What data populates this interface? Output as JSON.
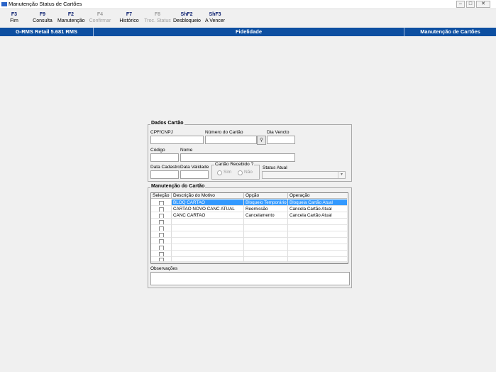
{
  "window": {
    "title": "Manutenção Status de Cartões"
  },
  "toolbar": {
    "buttons": [
      {
        "key": "F3",
        "label": "Fim"
      },
      {
        "key": "F9",
        "label": "Consulta"
      },
      {
        "key": "F2",
        "label": "Manutenção"
      },
      {
        "key": "F4",
        "label": "Confirmar"
      },
      {
        "key": "F7",
        "label": "Histórico"
      },
      {
        "key": "F8",
        "label": "Troc. Status"
      },
      {
        "key": "ShF2",
        "label": "Desbloqueio"
      },
      {
        "key": "ShF3",
        "label": "A Vencer"
      }
    ]
  },
  "statusbar": {
    "system": "G-RMS Retail 5.681 RMS",
    "module": "Fidelidade",
    "screen": "Manutenção de Cartões"
  },
  "dados_cartao": {
    "title": "Dados Cartão",
    "cpf_label": "CPF/CNPJ",
    "numero_label": "Número do Cartão",
    "dia_vencto_label": "Dia Vencto",
    "codigo_label": "Código",
    "nome_label": "Nome",
    "data_cadastro_label": "Data Cadastro",
    "data_validade_label": "Data Validade",
    "recebido_label": "Cartão Recebido ?",
    "sim_label": "Sim",
    "nao_label": "Não",
    "status_label": "Status Atual"
  },
  "manutencao": {
    "title": "Manutenção do Cartão",
    "columns": [
      "Seleção",
      "Descrição do Motivo",
      "Opção",
      "Operação"
    ],
    "rows": [
      {
        "descricao": "BLOQ CARTAO",
        "opcao": "Bloqueio Temporário",
        "operacao": "Bloqueia Cartão Atual"
      },
      {
        "descricao": "CARTAO NOVO CANC ATUAL",
        "opcao": "Reemissão",
        "operacao": "Cancela Cartão Atual"
      },
      {
        "descricao": "CANC CARTAO",
        "opcao": "Cancelamento",
        "operacao": "Cancela Cartão Atual"
      }
    ],
    "selected_row": 0,
    "observacoes_label": "Observações"
  },
  "colors": {
    "statusbar_bg": "#0d4fa1",
    "selection": "#3399ff",
    "disabled_text": "#a0a0a0"
  }
}
